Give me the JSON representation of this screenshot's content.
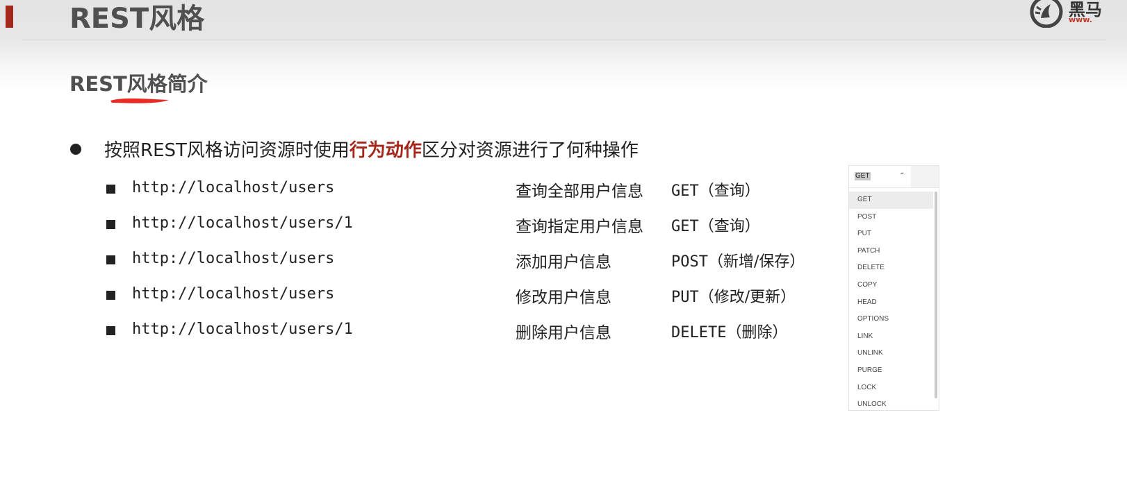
{
  "slide": {
    "title": "REST风格",
    "subtitle": "REST风格简介",
    "logo_text": "黑马",
    "logo_url": "www."
  },
  "intro": {
    "before": "按照REST风格访问资源时使用",
    "emphasis": "行为动作",
    "after": "区分对资源进行了何种操作"
  },
  "rows": [
    {
      "url": "http://localhost/users",
      "desc": "查询全部用户信息",
      "method": "GET",
      "note": "（查询）"
    },
    {
      "url": "http://localhost/users/1",
      "desc": "查询指定用户信息",
      "method": "GET",
      "note": "（查询）"
    },
    {
      "url": "http://localhost/users",
      "desc": "添加用户信息",
      "method": "POST",
      "note": "（新增/保存）"
    },
    {
      "url": "http://localhost/users",
      "desc": "修改用户信息",
      "method": "PUT",
      "note": "（修改/更新）"
    },
    {
      "url": "http://localhost/users/1",
      "desc": "删除用户信息",
      "method": "DELETE",
      "note": "（删除）"
    }
  ],
  "method_dropdown": {
    "selected": "GET",
    "options": [
      "GET",
      "POST",
      "PUT",
      "PATCH",
      "DELETE",
      "COPY",
      "HEAD",
      "OPTIONS",
      "LINK",
      "UNLINK",
      "PURGE",
      "LOCK",
      "UNLOCK"
    ]
  },
  "colors": {
    "accent_red": "#a3271b",
    "title_gray": "#505050",
    "highlight_red": "#e8140c"
  }
}
